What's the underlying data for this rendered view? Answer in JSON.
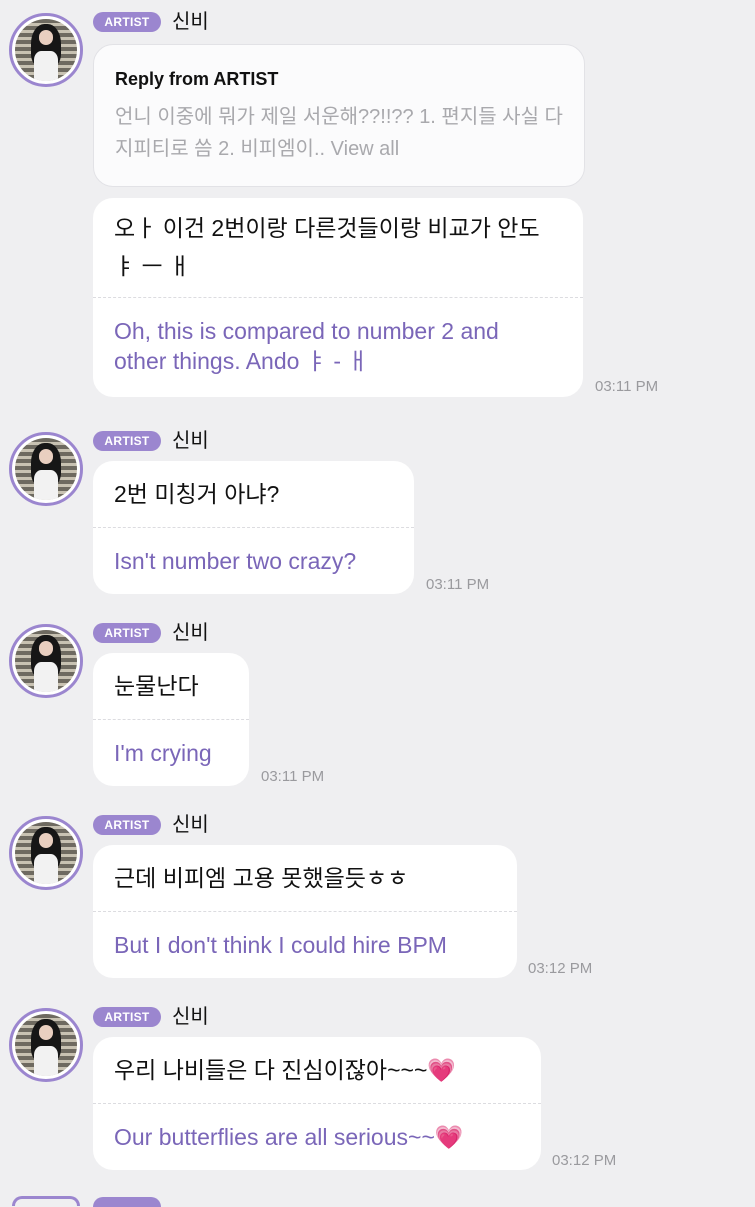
{
  "messages": [
    {
      "badge": "ARTIST",
      "name": "신비",
      "reply": {
        "title": "Reply from ARTIST",
        "text": "언니 이중에 뭐가 제일 서운해??!!?? 1. 편지들 사실 다 지피티로 씀 2. 비피엠이..",
        "view_all": "View all"
      },
      "original_lines": [
        "오ㅏ 이건 2번이랑 다른것들이랑 비교가 안도",
        "ㅑ ㅡ ㅐ"
      ],
      "translation_lines": [
        "Oh, this is compared to number 2 and",
        "other things. Ando ㅑ - ㅐ"
      ],
      "time": "03:11 PM"
    },
    {
      "badge": "ARTIST",
      "name": "신비",
      "original_lines": [
        "2번 미칭거 아냐?"
      ],
      "translation_lines": [
        "Isn't number two crazy?"
      ],
      "time": "03:11 PM"
    },
    {
      "badge": "ARTIST",
      "name": "신비",
      "original_lines": [
        "눈물난다"
      ],
      "translation_lines": [
        "I'm crying"
      ],
      "time": "03:11 PM"
    },
    {
      "badge": "ARTIST",
      "name": "신비",
      "original_lines": [
        "근데 비피엠 고용 못했을듯ㅎㅎ"
      ],
      "translation_lines": [
        "But I don't think I could hire BPM"
      ],
      "time": "03:12 PM"
    },
    {
      "badge": "ARTIST",
      "name": "신비",
      "original_lines": [
        "우리 나비들은 다 진심이잖아~~~"
      ],
      "translation_lines": [
        "Our butterflies are all serious~~"
      ],
      "emoji": "💗",
      "time": "03:12 PM"
    }
  ],
  "colors": {
    "background": "#efeff1",
    "badge": "#9b86cf",
    "translation": "#7a66b8",
    "timestamp": "#9a9a9e"
  }
}
